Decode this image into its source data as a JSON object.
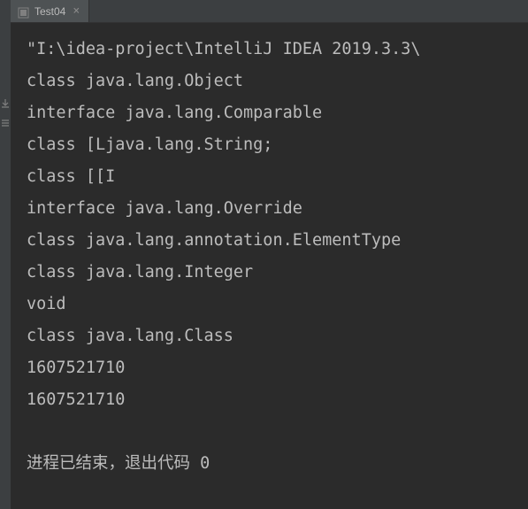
{
  "tab": {
    "label": "Test04",
    "close_symbol": "×"
  },
  "console": {
    "lines": [
      "\"I:\\idea-project\\IntelliJ IDEA 2019.3.3\\",
      "class java.lang.Object",
      "interface java.lang.Comparable",
      "class [Ljava.lang.String;",
      "class [[I",
      "interface java.lang.Override",
      "class java.lang.annotation.ElementType",
      "class java.lang.Integer",
      "void",
      "class java.lang.Class",
      "1607521710",
      "1607521710",
      "",
      "进程已结束，退出代码 0"
    ]
  },
  "gutter_icons": [
    "download-icon",
    "list-icon"
  ]
}
